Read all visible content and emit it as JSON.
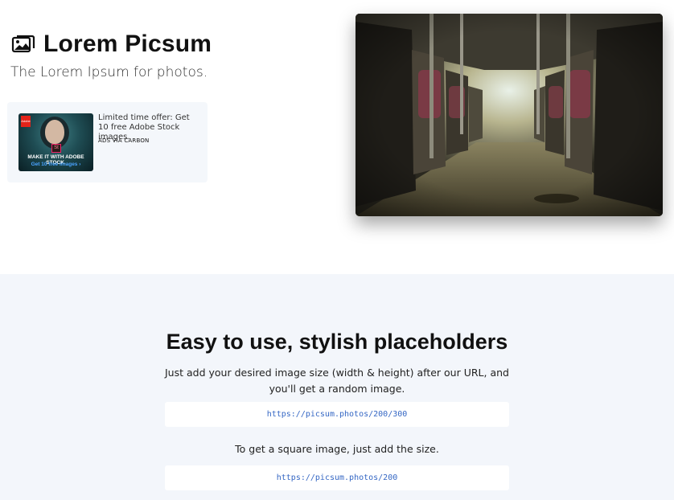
{
  "header": {
    "brand_title": "Lorem Picsum",
    "tagline": "The Lorem Ipsum for photos.",
    "brand_icon": "images-icon"
  },
  "ad": {
    "text": "Limited time offer: Get 10 free Adobe Stock images.",
    "via": "ADS VIA CARBON",
    "image_logo": "Adobe",
    "image_line1": "MAKE IT WITH ADOBE STOCK.",
    "image_line2": "Get 10 free images ›",
    "image_badge": "St"
  },
  "hero_photo": {
    "subject": "bus interior",
    "icon": "photo-image"
  },
  "usage": {
    "title": "Easy to use, stylish placeholders",
    "desc1": "Just add your desired image size (width & height) after our URL, and you'll get a random image.",
    "code1": "https://picsum.photos/200/300",
    "desc2": "To get a square image, just add the size.",
    "code2": "https://picsum.photos/200"
  },
  "colors": {
    "section_bg": "#f3f6fb",
    "code_text": "#3567c4",
    "ad_bg": "#f4f7fb"
  }
}
